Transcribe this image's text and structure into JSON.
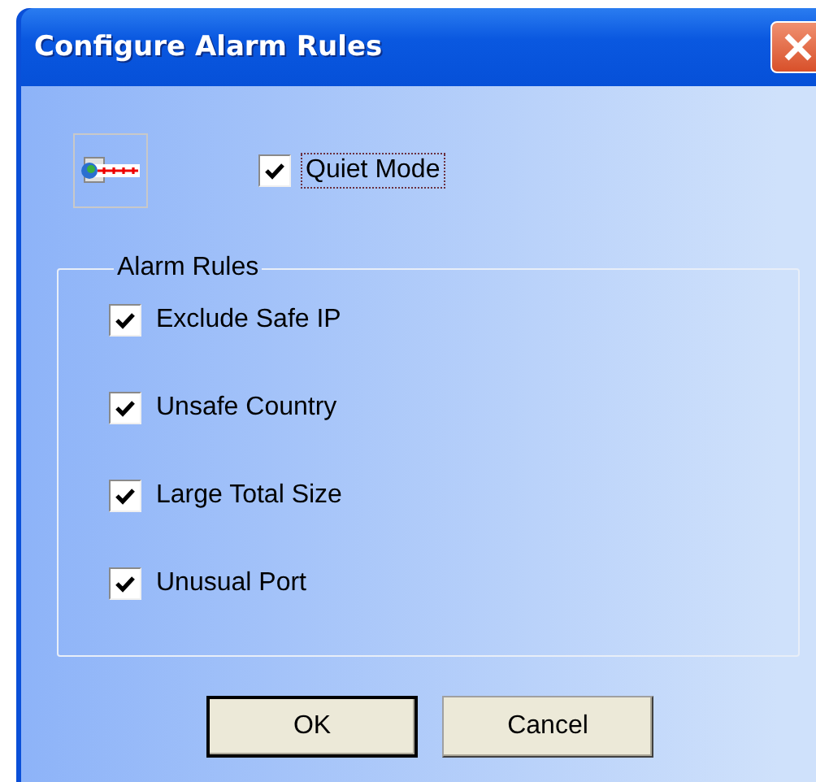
{
  "window": {
    "title": "Configure Alarm Rules"
  },
  "quiet_mode": {
    "label": "Quiet Mode",
    "checked": true,
    "focused": true
  },
  "alarm_rules": {
    "title": "Alarm Rules",
    "rules": [
      {
        "label": "Exclude Safe IP",
        "checked": true
      },
      {
        "label": "Unsafe Country",
        "checked": true
      },
      {
        "label": "Large Total Size",
        "checked": true
      },
      {
        "label": "Unusual Port",
        "checked": true
      }
    ]
  },
  "buttons": [
    {
      "label": "OK",
      "default": true
    },
    {
      "label": "Cancel",
      "default": false
    }
  ]
}
